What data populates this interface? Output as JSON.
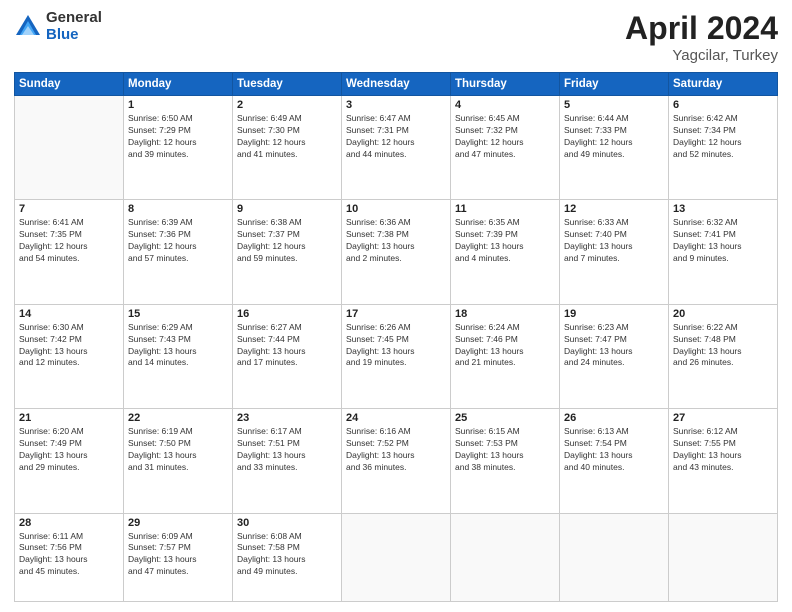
{
  "logo": {
    "general": "General",
    "blue": "Blue"
  },
  "title": {
    "month_year": "April 2024",
    "location": "Yagcilar, Turkey"
  },
  "days_of_week": [
    "Sunday",
    "Monday",
    "Tuesday",
    "Wednesday",
    "Thursday",
    "Friday",
    "Saturday"
  ],
  "weeks": [
    [
      {
        "day": "",
        "info": ""
      },
      {
        "day": "1",
        "info": "Sunrise: 6:50 AM\nSunset: 7:29 PM\nDaylight: 12 hours\nand 39 minutes."
      },
      {
        "day": "2",
        "info": "Sunrise: 6:49 AM\nSunset: 7:30 PM\nDaylight: 12 hours\nand 41 minutes."
      },
      {
        "day": "3",
        "info": "Sunrise: 6:47 AM\nSunset: 7:31 PM\nDaylight: 12 hours\nand 44 minutes."
      },
      {
        "day": "4",
        "info": "Sunrise: 6:45 AM\nSunset: 7:32 PM\nDaylight: 12 hours\nand 47 minutes."
      },
      {
        "day": "5",
        "info": "Sunrise: 6:44 AM\nSunset: 7:33 PM\nDaylight: 12 hours\nand 49 minutes."
      },
      {
        "day": "6",
        "info": "Sunrise: 6:42 AM\nSunset: 7:34 PM\nDaylight: 12 hours\nand 52 minutes."
      }
    ],
    [
      {
        "day": "7",
        "info": "Sunrise: 6:41 AM\nSunset: 7:35 PM\nDaylight: 12 hours\nand 54 minutes."
      },
      {
        "day": "8",
        "info": "Sunrise: 6:39 AM\nSunset: 7:36 PM\nDaylight: 12 hours\nand 57 minutes."
      },
      {
        "day": "9",
        "info": "Sunrise: 6:38 AM\nSunset: 7:37 PM\nDaylight: 12 hours\nand 59 minutes."
      },
      {
        "day": "10",
        "info": "Sunrise: 6:36 AM\nSunset: 7:38 PM\nDaylight: 13 hours\nand 2 minutes."
      },
      {
        "day": "11",
        "info": "Sunrise: 6:35 AM\nSunset: 7:39 PM\nDaylight: 13 hours\nand 4 minutes."
      },
      {
        "day": "12",
        "info": "Sunrise: 6:33 AM\nSunset: 7:40 PM\nDaylight: 13 hours\nand 7 minutes."
      },
      {
        "day": "13",
        "info": "Sunrise: 6:32 AM\nSunset: 7:41 PM\nDaylight: 13 hours\nand 9 minutes."
      }
    ],
    [
      {
        "day": "14",
        "info": "Sunrise: 6:30 AM\nSunset: 7:42 PM\nDaylight: 13 hours\nand 12 minutes."
      },
      {
        "day": "15",
        "info": "Sunrise: 6:29 AM\nSunset: 7:43 PM\nDaylight: 13 hours\nand 14 minutes."
      },
      {
        "day": "16",
        "info": "Sunrise: 6:27 AM\nSunset: 7:44 PM\nDaylight: 13 hours\nand 17 minutes."
      },
      {
        "day": "17",
        "info": "Sunrise: 6:26 AM\nSunset: 7:45 PM\nDaylight: 13 hours\nand 19 minutes."
      },
      {
        "day": "18",
        "info": "Sunrise: 6:24 AM\nSunset: 7:46 PM\nDaylight: 13 hours\nand 21 minutes."
      },
      {
        "day": "19",
        "info": "Sunrise: 6:23 AM\nSunset: 7:47 PM\nDaylight: 13 hours\nand 24 minutes."
      },
      {
        "day": "20",
        "info": "Sunrise: 6:22 AM\nSunset: 7:48 PM\nDaylight: 13 hours\nand 26 minutes."
      }
    ],
    [
      {
        "day": "21",
        "info": "Sunrise: 6:20 AM\nSunset: 7:49 PM\nDaylight: 13 hours\nand 29 minutes."
      },
      {
        "day": "22",
        "info": "Sunrise: 6:19 AM\nSunset: 7:50 PM\nDaylight: 13 hours\nand 31 minutes."
      },
      {
        "day": "23",
        "info": "Sunrise: 6:17 AM\nSunset: 7:51 PM\nDaylight: 13 hours\nand 33 minutes."
      },
      {
        "day": "24",
        "info": "Sunrise: 6:16 AM\nSunset: 7:52 PM\nDaylight: 13 hours\nand 36 minutes."
      },
      {
        "day": "25",
        "info": "Sunrise: 6:15 AM\nSunset: 7:53 PM\nDaylight: 13 hours\nand 38 minutes."
      },
      {
        "day": "26",
        "info": "Sunrise: 6:13 AM\nSunset: 7:54 PM\nDaylight: 13 hours\nand 40 minutes."
      },
      {
        "day": "27",
        "info": "Sunrise: 6:12 AM\nSunset: 7:55 PM\nDaylight: 13 hours\nand 43 minutes."
      }
    ],
    [
      {
        "day": "28",
        "info": "Sunrise: 6:11 AM\nSunset: 7:56 PM\nDaylight: 13 hours\nand 45 minutes."
      },
      {
        "day": "29",
        "info": "Sunrise: 6:09 AM\nSunset: 7:57 PM\nDaylight: 13 hours\nand 47 minutes."
      },
      {
        "day": "30",
        "info": "Sunrise: 6:08 AM\nSunset: 7:58 PM\nDaylight: 13 hours\nand 49 minutes."
      },
      {
        "day": "",
        "info": ""
      },
      {
        "day": "",
        "info": ""
      },
      {
        "day": "",
        "info": ""
      },
      {
        "day": "",
        "info": ""
      }
    ]
  ]
}
